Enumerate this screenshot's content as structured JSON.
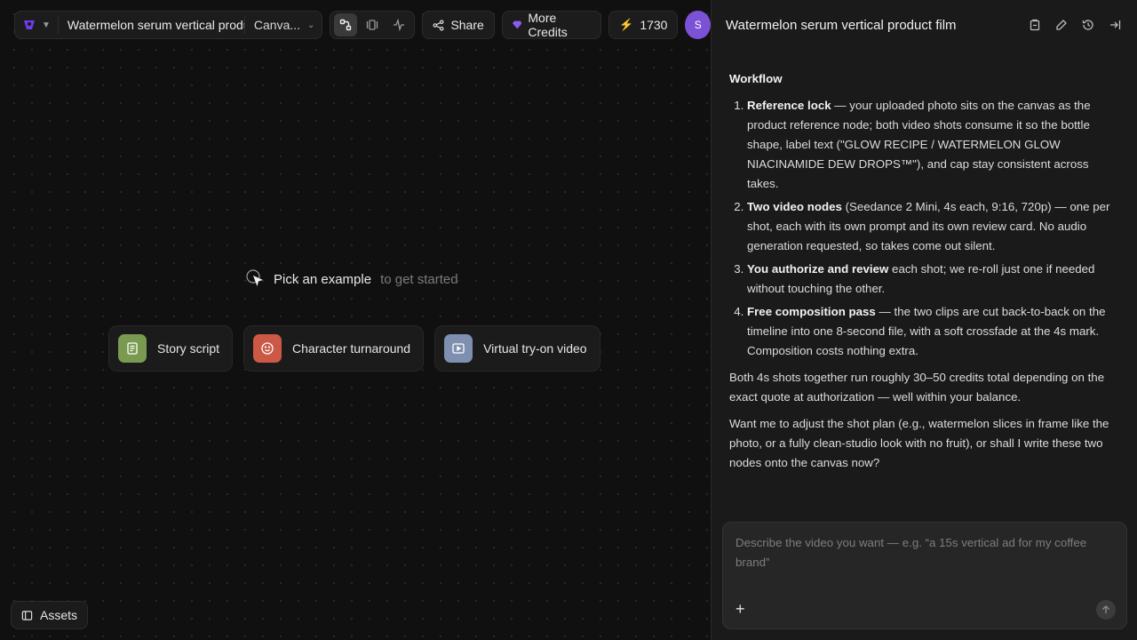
{
  "project": {
    "name": "Watermelon serum vertical product film",
    "view_label": "Canva..."
  },
  "toolbar": {
    "share_label": "Share",
    "credits_label": "More Credits",
    "balance": "1730",
    "avatar_initial": "S"
  },
  "canvas": {
    "prompt_main": "Pick an example",
    "prompt_sub": "to get started",
    "examples": [
      {
        "label": "Story script",
        "icon": "script-icon",
        "color": "#7a9a52"
      },
      {
        "label": "Character turnaround",
        "icon": "smile-icon",
        "color": "#cc5846"
      },
      {
        "label": "Virtual try-on video",
        "icon": "video-icon",
        "color": "#7e8fb0"
      }
    ],
    "assets_label": "Assets"
  },
  "panel": {
    "title": "Watermelon serum vertical product film",
    "heading": "Workflow",
    "steps": [
      {
        "bold": "Reference lock",
        "text": " — your uploaded photo sits on the canvas as the product reference node; both video shots consume it so the bottle shape, label text (\"GLOW RECIPE / WATERMELON GLOW NIACINAMIDE DEW DROPS™\"), and cap stay consistent across takes."
      },
      {
        "bold": "Two video nodes",
        "text": " (Seedance 2 Mini, 4s each, 9:16, 720p) — one per shot, each with its own prompt and its own review card. No audio generation requested, so takes come out silent."
      },
      {
        "bold": "You authorize and review",
        "text": " each shot; we re-roll just one if needed without touching the other."
      },
      {
        "bold": "Free composition pass",
        "text": " — the two clips are cut back-to-back on the timeline into one 8-second file, with a soft crossfade at the 4s mark. Composition costs nothing extra."
      }
    ],
    "para1": "Both 4s shots together run roughly 30–50 credits total depending on the exact quote at authorization — well within your balance.",
    "para2": "Want me to adjust the shot plan (e.g., watermelon slices in frame like the photo, or a fully clean-studio look with no fruit), or shall I write these two nodes onto the canvas now?",
    "composer_placeholder": "Describe the video you want — e.g. “a 15s vertical ad for my coffee brand”"
  }
}
